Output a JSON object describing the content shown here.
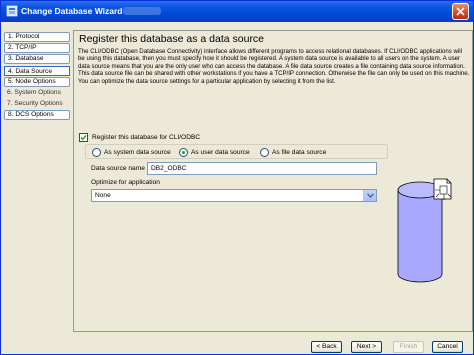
{
  "window": {
    "title": "Change Database Wizard"
  },
  "nav": {
    "items": [
      {
        "label": "1. Protocol",
        "state": "enabled"
      },
      {
        "label": "2. TCP/IP",
        "state": "enabled"
      },
      {
        "label": "3. Database",
        "state": "enabled"
      },
      {
        "label": "4. Data Source",
        "state": "active"
      },
      {
        "label": "5. Node Options",
        "state": "enabled"
      },
      {
        "label": "6. System Options",
        "state": "disabled"
      },
      {
        "label": "7. Security Options",
        "state": "disabled"
      },
      {
        "label": "8. DCS Options",
        "state": "enabled"
      }
    ]
  },
  "main": {
    "heading": "Register this database as a data source",
    "description": "The CLI/ODBC (Open Database Connectivity) interface allows different programs to access relational databases. If CLI/ODBC applications will be using this database, then you must specify how it should be registered. A system data source is available to all users on the system. A user data source means that you are the only user who can access the database. A file data source creates a file containing data source information. This data source file can be shared with other workstations if you have a TCP/IP connection. Otherwise the file can only be used on this machine. You can optimize the data source settings for a particular application by selecting it from the list.",
    "register_checkbox": {
      "label": "Register this database for CLI/ODBC",
      "checked": true
    },
    "radios": [
      {
        "label": "As system data source",
        "checked": false
      },
      {
        "label": "As user data source",
        "checked": true
      },
      {
        "label": "As file data source",
        "checked": false
      }
    ],
    "data_source_name_label": "Data source name",
    "data_source_name_value": "DB2_ODBC",
    "optimize_label": "Optimize for application",
    "optimize_value": "None"
  },
  "footer": {
    "back": "< Back",
    "next": "Next >",
    "finish": "Finish",
    "cancel": "Cancel"
  },
  "colors": {
    "titlebar": "#0a56e3",
    "window_bg": "#ece9d8",
    "accent_border": "#7f9db9",
    "radio_dot": "#21a121",
    "database_cylinder": "#a9a9ff"
  }
}
